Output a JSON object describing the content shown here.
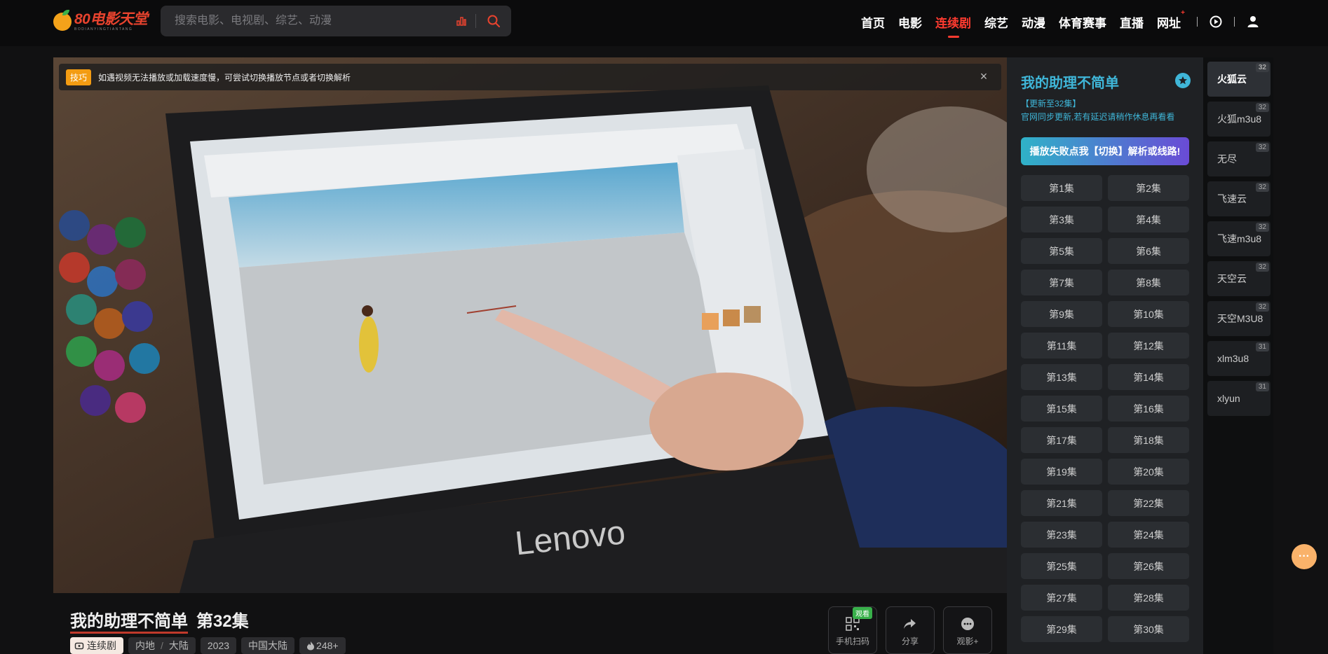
{
  "header": {
    "logo_title": "80电影天堂",
    "logo_sub": "BODIANYINGTIANTANG",
    "search_placeholder": "搜索电影、电视剧、综艺、动漫",
    "nav": [
      "首页",
      "电影",
      "连续剧",
      "综艺",
      "动漫",
      "体育赛事",
      "直播",
      "网址"
    ],
    "active_nav": "连续剧",
    "nav_dot": "+"
  },
  "player": {
    "tip_badge": "技巧",
    "tip_text": "如遇视频无法播放或加载速度慢，可尝试切换播放节点或者切换解析",
    "close_glyph": "×"
  },
  "episodes": {
    "title": "我的助理不简单",
    "update": "【更新至32集】",
    "note": "官网同步更新,若有延迟请稍作休息再看看",
    "switch_label": "播放失败点我【切换】解析或线路!",
    "items": [
      "第1集",
      "第2集",
      "第3集",
      "第4集",
      "第5集",
      "第6集",
      "第7集",
      "第8集",
      "第9集",
      "第10集",
      "第11集",
      "第12集",
      "第13集",
      "第14集",
      "第15集",
      "第16集",
      "第17集",
      "第18集",
      "第19集",
      "第20集",
      "第21集",
      "第22集",
      "第23集",
      "第24集",
      "第25集",
      "第26集",
      "第27集",
      "第28集",
      "第29集",
      "第30集"
    ]
  },
  "sources": [
    {
      "name": "火狐云",
      "count": "32"
    },
    {
      "name": "火狐m3u8",
      "count": "32"
    },
    {
      "name": "无尽",
      "count": "32"
    },
    {
      "name": "飞速云",
      "count": "32"
    },
    {
      "name": "飞速m3u8",
      "count": "32"
    },
    {
      "name": "天空云",
      "count": "32"
    },
    {
      "name": "天空M3U8",
      "count": "32"
    },
    {
      "name": "xlm3u8",
      "count": "31"
    },
    {
      "name": "xlyun",
      "count": "31"
    }
  ],
  "info": {
    "title": "我的助理不简单",
    "episode": "第32集",
    "category": "连续剧",
    "region_a": "内地",
    "region_b": "大陆",
    "year": "2023",
    "country": "中国大陆",
    "heat": "248+",
    "sep": "/"
  },
  "actions": {
    "scan_label": "手机扫码",
    "scan_badge": "观看",
    "share_label": "分享",
    "watch_label": "观影+"
  },
  "float_glyph": "···",
  "colors": {
    "accent_red": "#ff3b30",
    "accent_cyan": "#3fb6d8",
    "panel": "#1f2124"
  }
}
